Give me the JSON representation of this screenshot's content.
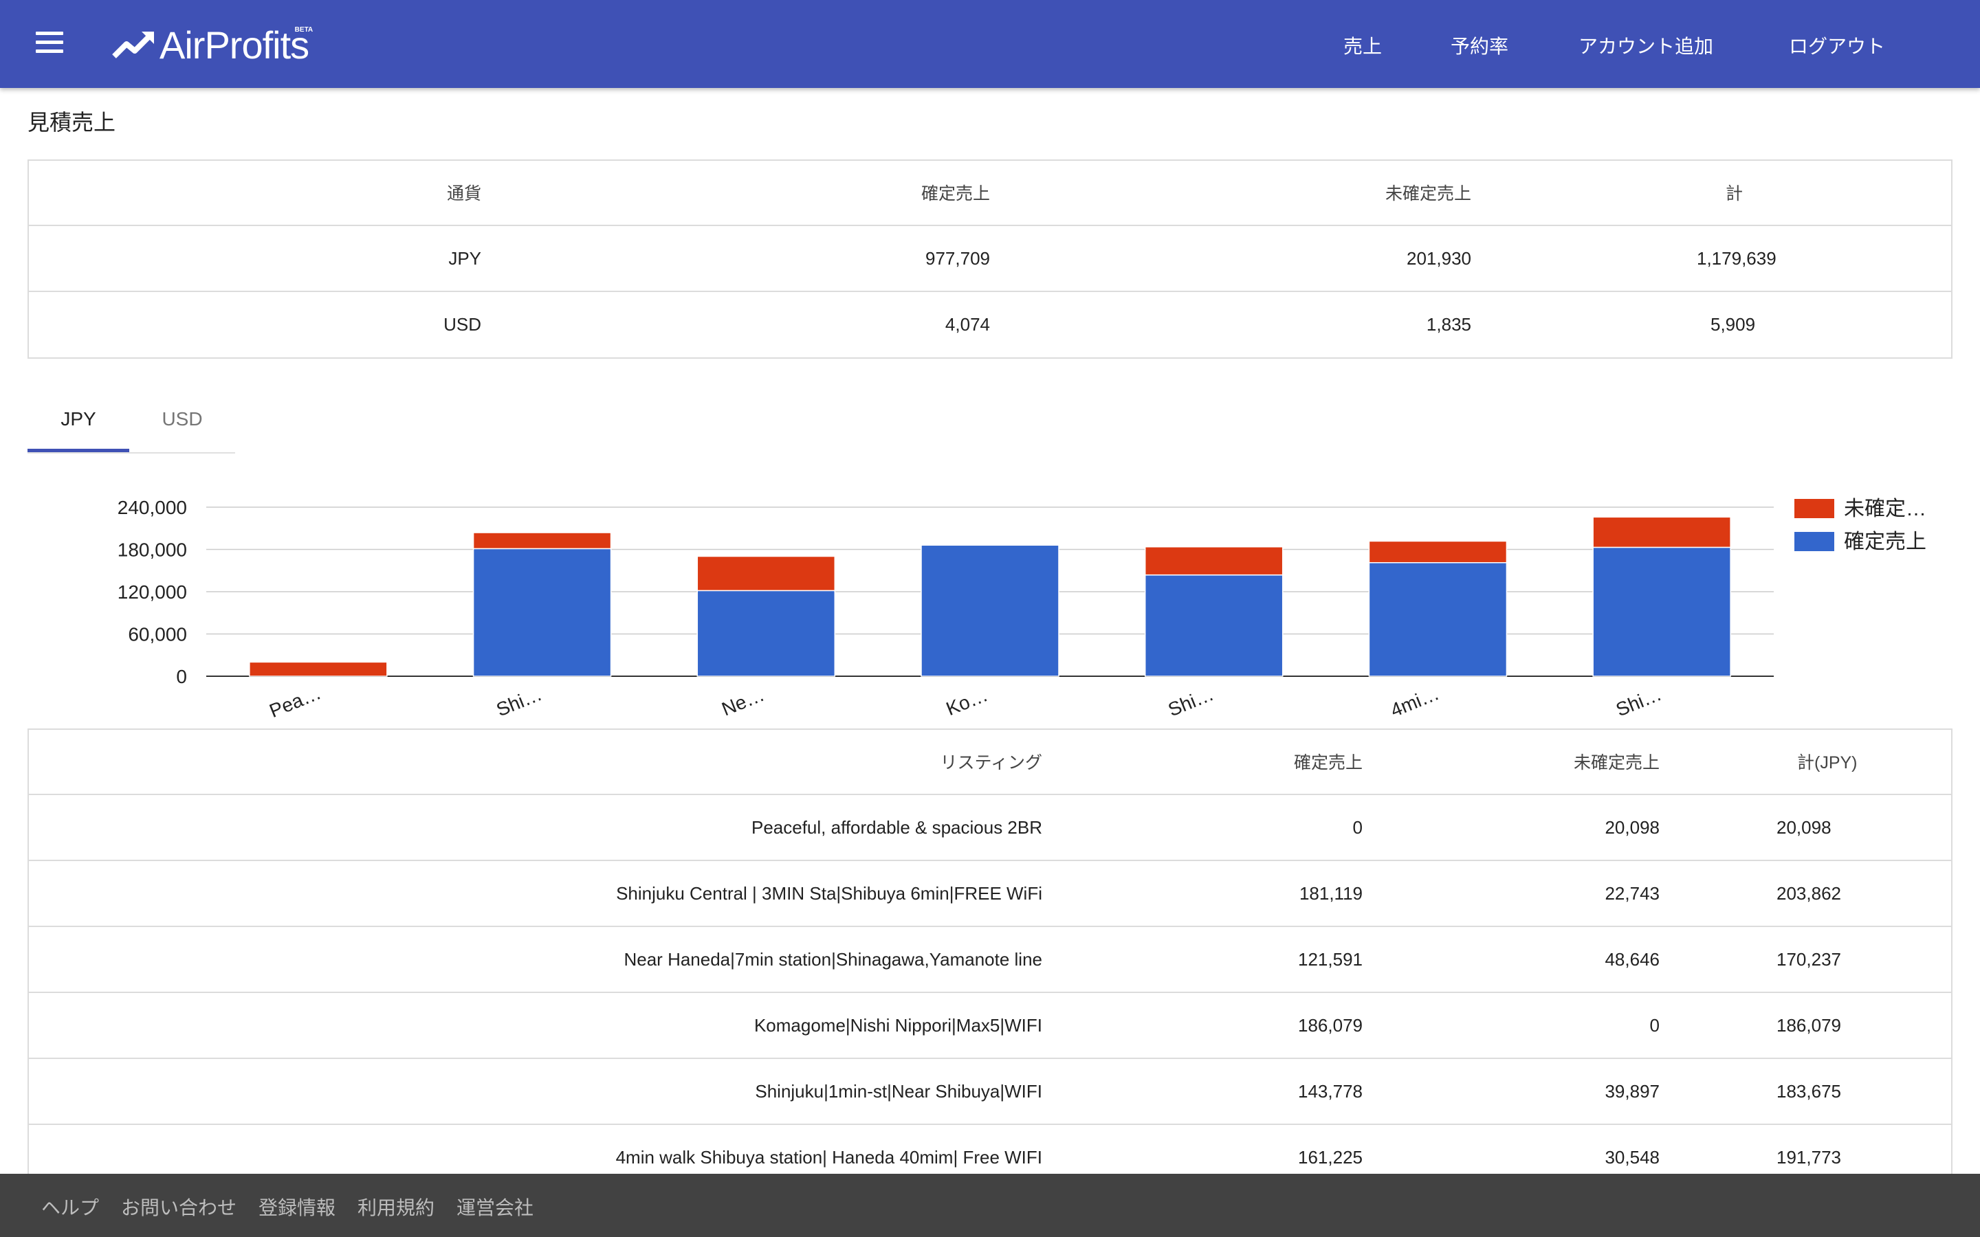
{
  "header": {
    "logo_text": "AirProfits",
    "logo_badge": "BETA",
    "nav": [
      "売上",
      "予約率",
      "アカウント追加",
      "ログアウト"
    ]
  },
  "section_title": "見積売上",
  "summary": {
    "headers": [
      "通貨",
      "確定売上",
      "未確定売上",
      "計"
    ],
    "rows": [
      [
        "JPY",
        "977,709",
        "201,930",
        "1,179,639"
      ],
      [
        "USD",
        "4,074",
        "1,835",
        "5,909"
      ]
    ]
  },
  "tabs": [
    {
      "label": "JPY",
      "active": true
    },
    {
      "label": "USD",
      "active": false
    }
  ],
  "chart_data": {
    "type": "bar",
    "stacked": true,
    "categories": [
      "Pea…",
      "Shi…",
      "Ne…",
      "Ko…",
      "Shi…",
      "4mi…",
      "Shi…"
    ],
    "series": [
      {
        "name": "確定売上",
        "color": "#3366cc",
        "values": [
          0,
          181119,
          121591,
          186079,
          143778,
          161225,
          183000
        ]
      },
      {
        "name": "未確定売上",
        "legend_label": "未確定…",
        "color": "#dc3912",
        "values": [
          20098,
          22743,
          48646,
          0,
          39897,
          30548,
          43000
        ]
      }
    ],
    "yticks": [
      "0",
      "60,000",
      "120,000",
      "180,000",
      "240,000"
    ],
    "ylim": [
      0,
      240000
    ],
    "legend": "right",
    "grid": true
  },
  "listings": {
    "headers": [
      "リスティング",
      "確定売上",
      "未確定売上",
      "計(JPY)"
    ],
    "rows": [
      [
        "Peaceful, affordable & spacious 2BR",
        "0",
        "20,098",
        "20,098"
      ],
      [
        "Shinjuku Central | 3MIN Sta|Shibuya 6min|FREE WiFi",
        "181,119",
        "22,743",
        "203,862"
      ],
      [
        "Near Haneda|7min station|Shinagawa,Yamanote line",
        "121,591",
        "48,646",
        "170,237"
      ],
      [
        "Komagome|Nishi Nippori|Max5|WIFI",
        "186,079",
        "0",
        "186,079"
      ],
      [
        "Shinjuku|1min-st|Near Shibuya|WIFI",
        "143,778",
        "39,897",
        "183,675"
      ],
      [
        "4min walk Shibuya station| Haneda 40mim| Free WIFI",
        "161,225",
        "30,548",
        "191,773"
      ]
    ]
  },
  "footer": [
    "ヘルプ",
    "お問い合わせ",
    "登録情報",
    "利用規約",
    "運営会社"
  ]
}
